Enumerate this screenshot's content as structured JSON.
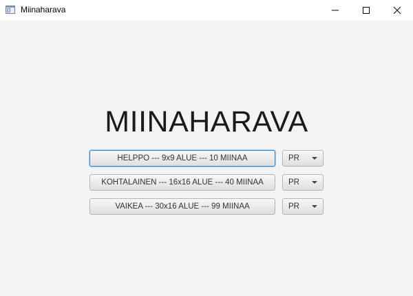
{
  "window": {
    "title": "Miinaharava"
  },
  "main": {
    "title": "MIINAHARAVA",
    "difficulties": [
      {
        "label": "HELPPO --- 9x9 ALUE --- 10 MIINAA",
        "selector_value": "PR"
      },
      {
        "label": "KOHTALAINEN --- 16x16 ALUE --- 40 MIINAA",
        "selector_value": "PR"
      },
      {
        "label": "VAIKEA --- 30x16 ALUE --- 99 MIINAA",
        "selector_value": "PR"
      }
    ]
  },
  "colors": {
    "background": "#f3f3f3",
    "focus_border": "#2f8bd6"
  },
  "icons": {
    "app": "window-app-icon",
    "minimize": "minimize-icon",
    "maximize": "maximize-icon",
    "close": "close-icon",
    "dropdown": "chevron-down-icon"
  }
}
